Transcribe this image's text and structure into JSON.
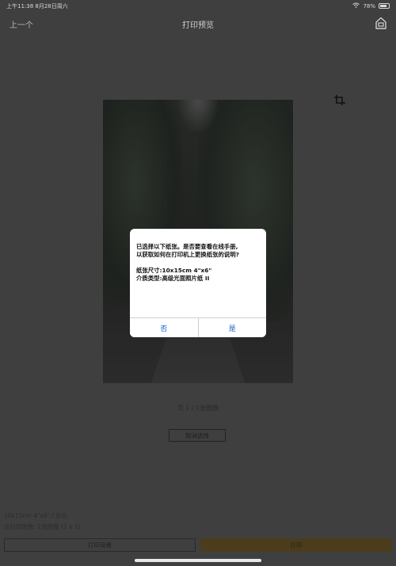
{
  "status_bar": {
    "time_date": "上午11:38  8月28日周六",
    "battery": "78%",
    "battery_level": 0.78
  },
  "nav": {
    "back_label": "上一个",
    "title": "打印预览",
    "home_icon": "home-icon"
  },
  "preview": {
    "crop_icon": "crop-icon",
    "page_indicator": "页 1 / 1张图像",
    "deselect_label": "取消选择"
  },
  "dialog": {
    "line1": "已选择以下纸张。是否要查看在线手册,",
    "line2": "以获取如何在打印机上更换纸张的说明?",
    "paper_size": "纸张尺寸:10x15cm 4\"x6\"",
    "media_type": "介质类型:高级光面照片纸 II",
    "no_label": "否",
    "yes_label": "是"
  },
  "footer": {
    "paper_info": "10x15cm 4\"x6\" / 彩色",
    "total_pages": "总打印张数: 1张图像 (1 x 1)",
    "settings_label": "打印设置",
    "print_label": "打印"
  },
  "colors": {
    "accent": "#1b5fc7",
    "print_button": "#4b3c1c",
    "overlay": "#3f3f3f"
  }
}
